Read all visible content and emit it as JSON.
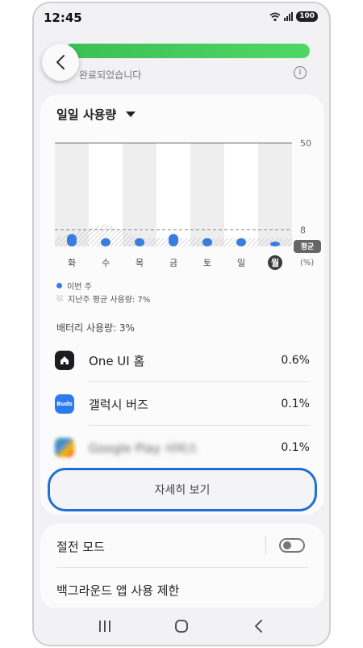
{
  "status_bar": {
    "time": "12:45",
    "battery": "100"
  },
  "header": {
    "complete_text": "완료되었습니다"
  },
  "daily_usage": {
    "title": "일일 사용량",
    "y_top": "50",
    "avg_value": "8",
    "avg_label": "평균",
    "unit": "(%)",
    "days": [
      "화",
      "수",
      "목",
      "금",
      "토",
      "일",
      "월"
    ],
    "legend_this_week": "이번 주",
    "legend_last_week": "지난주 평균 사용량: 7%"
  },
  "chart_data": {
    "type": "bar",
    "categories": [
      "화",
      "수",
      "목",
      "금",
      "토",
      "일",
      "월"
    ],
    "series": [
      {
        "name": "이번 주",
        "values": [
          6,
          4,
          4,
          6,
          4,
          4,
          2
        ]
      },
      {
        "name": "지난주 평균 사용량",
        "values": [
          4,
          11,
          4,
          4,
          4,
          4,
          4
        ]
      }
    ],
    "reference_line": 8,
    "reference_label": "평균",
    "ylabel": "(%)",
    "ylim": [
      0,
      50
    ],
    "highlight_category": "월",
    "colors": {
      "this_week": "#3a7de0",
      "last_week_hatch": "#bbbbbb",
      "column_bg": "#eeeeef"
    }
  },
  "battery": {
    "title": "배터리 사용량: 3%",
    "apps": [
      {
        "name": "One UI 홈",
        "pct": "0.6%",
        "icon": "home-icon"
      },
      {
        "name": "갤럭시 버즈",
        "pct": "0.1%",
        "icon": "buds-icon",
        "icon_text": "Buds"
      },
      {
        "name": "Google Play 서비스",
        "pct": "0.1%",
        "icon": "google-play-icon"
      }
    ]
  },
  "details_button": "자세히 보기",
  "settings": {
    "power_saving": "절전 모드",
    "background_limit": "백그라운드 앱 사용 제한"
  }
}
